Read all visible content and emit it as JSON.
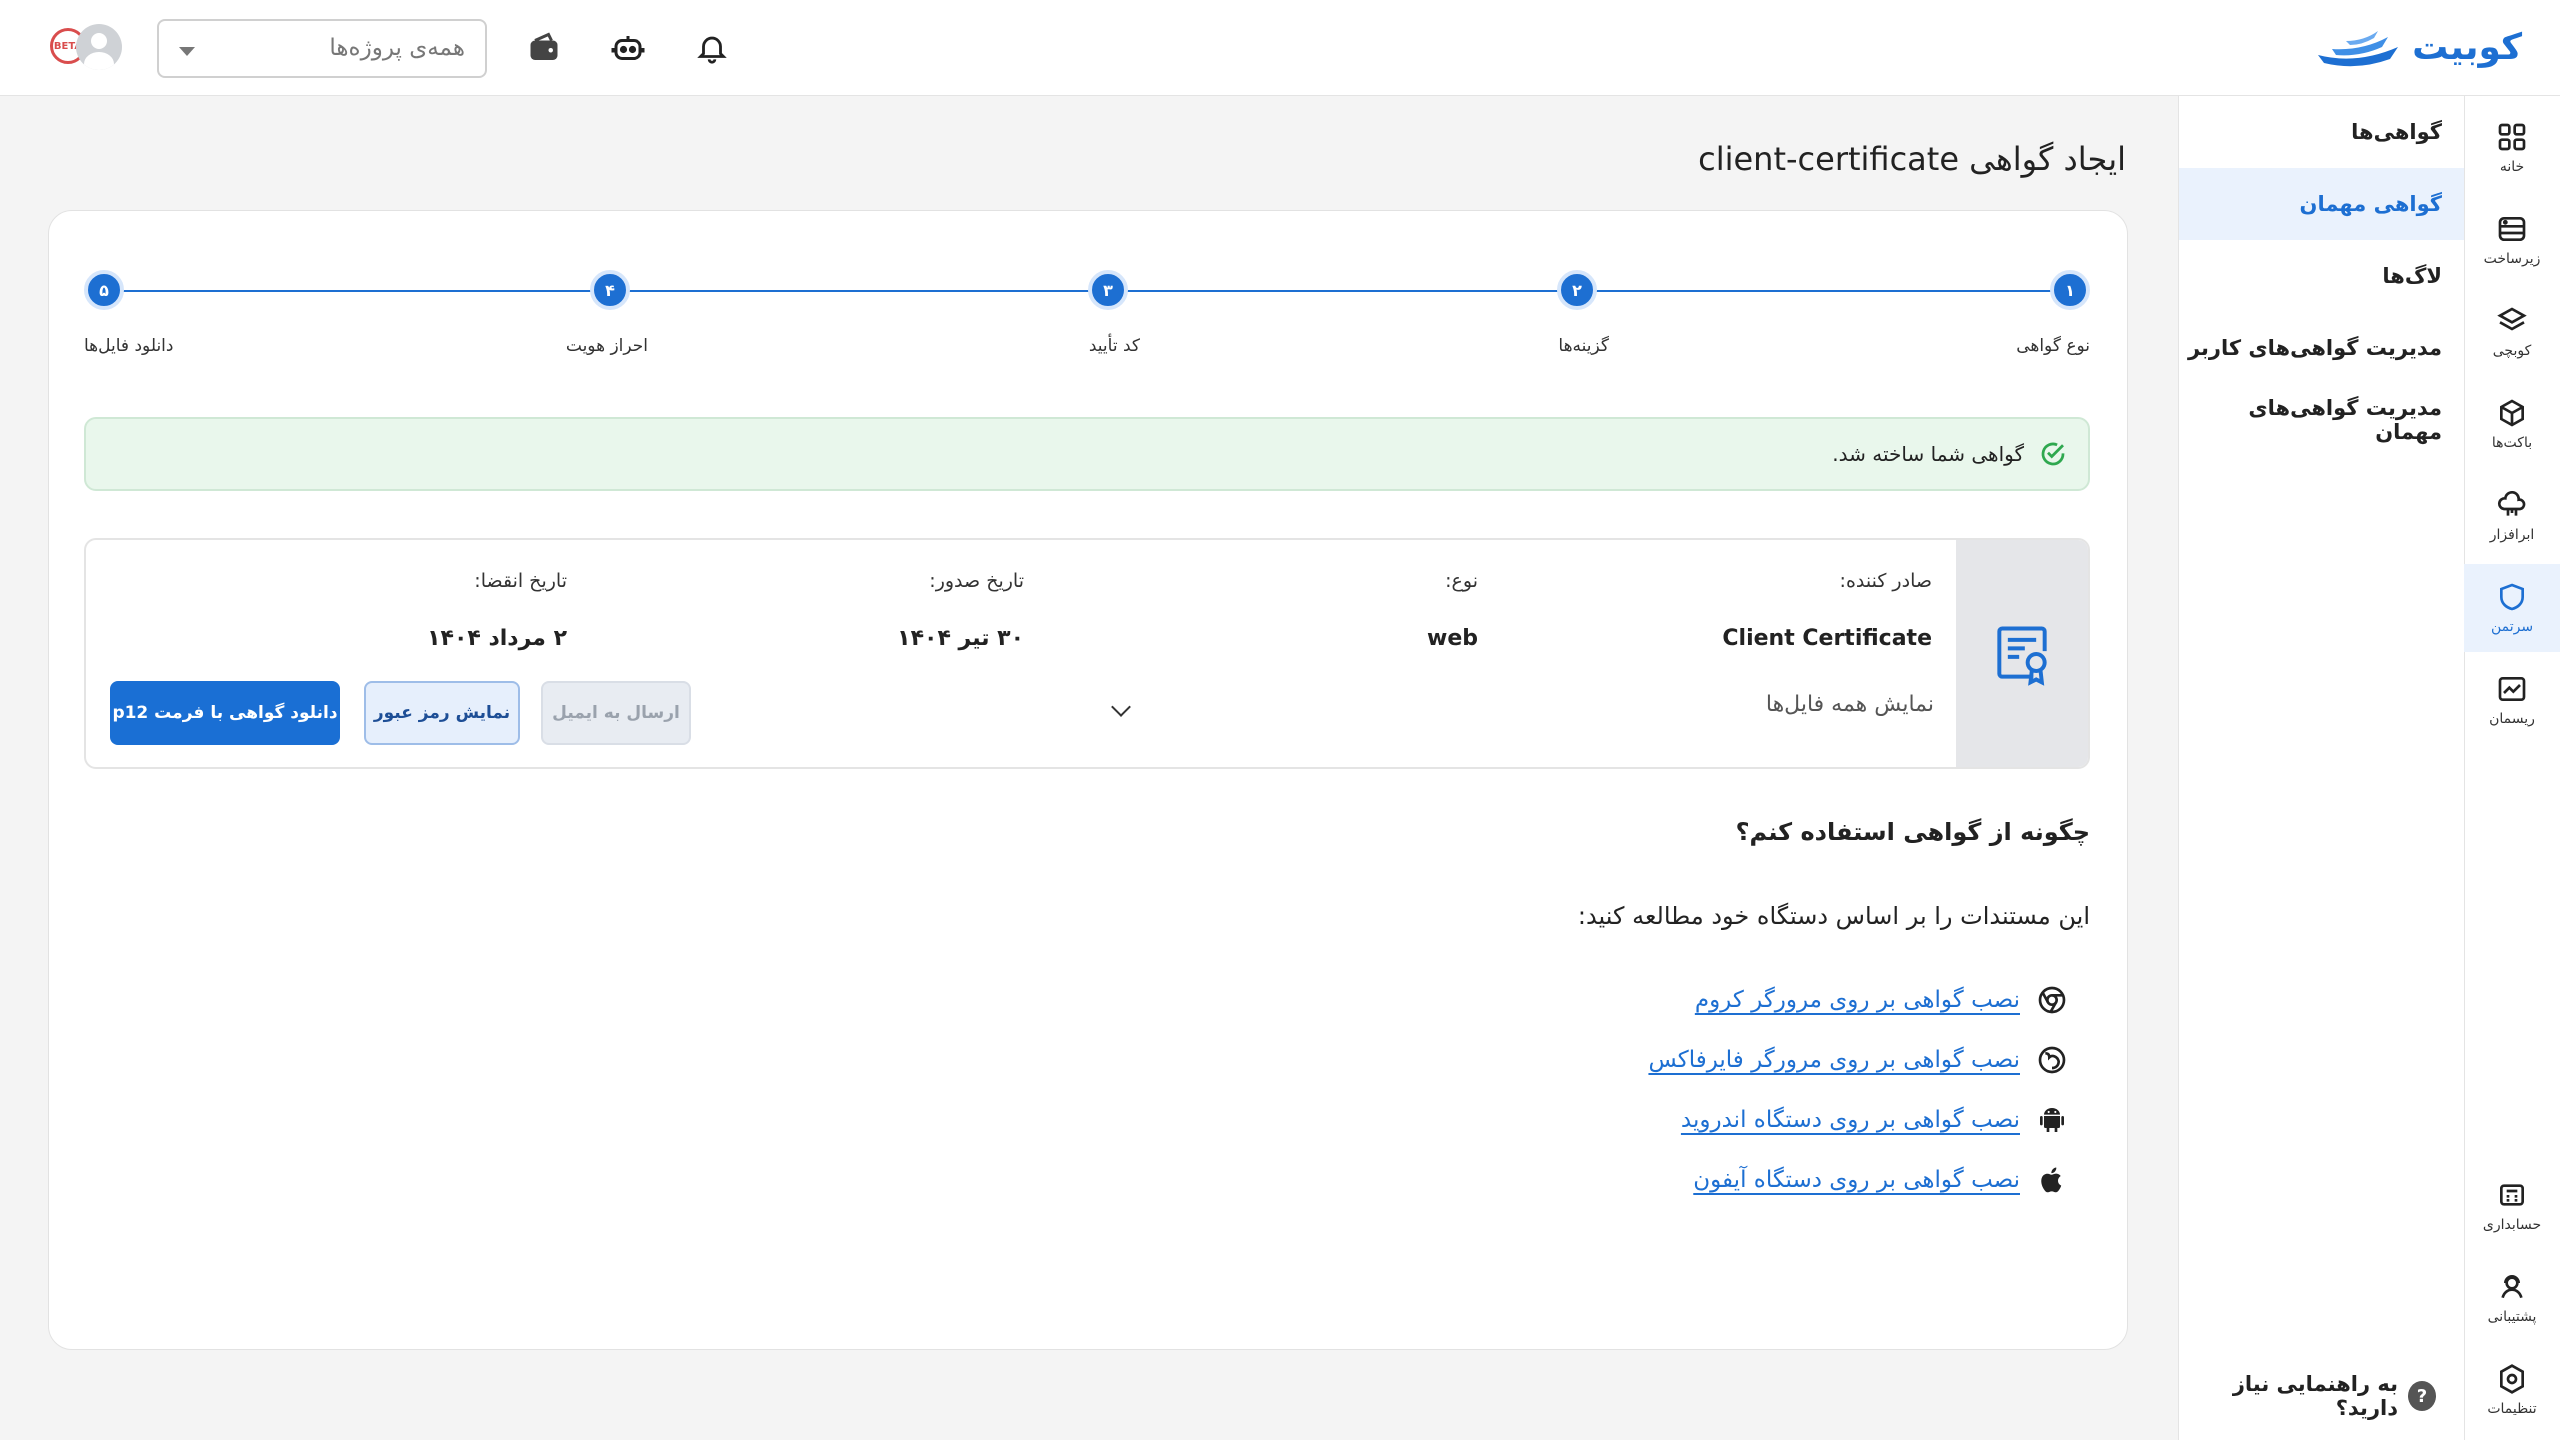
{
  "brand": {
    "name": "کوبیت"
  },
  "topbar": {
    "project_placeholder": "همه‌ی پروژه‌ها",
    "avatar_badge": "BETA"
  },
  "rail": {
    "items": [
      {
        "label": "خانه",
        "icon": "grid-icon"
      },
      {
        "label": "زیرساخت",
        "icon": "server-icon"
      },
      {
        "label": "کوبچی",
        "icon": "layers-icon"
      },
      {
        "label": "باکت‌ها",
        "icon": "cube-icon"
      },
      {
        "label": "ابرافزار",
        "icon": "cloud-app-icon"
      },
      {
        "label": "سرتمن",
        "icon": "shield-icon"
      },
      {
        "label": "ریسمان",
        "icon": "chart-icon"
      }
    ],
    "bottom": [
      {
        "label": "حسابداری",
        "icon": "calculator-icon"
      },
      {
        "label": "پشتیبانی",
        "icon": "support-icon"
      },
      {
        "label": "تنظیمات",
        "icon": "settings-icon"
      }
    ]
  },
  "subnav": {
    "items": [
      {
        "label": "گواهی‌ها"
      },
      {
        "label": "گواهی مهمان"
      },
      {
        "label": "لاگ‌ها"
      },
      {
        "label": "مدیریت گواهی‌های کاربر"
      },
      {
        "label": "مدیریت گواهی‌های مهمان"
      }
    ],
    "help": "به راهنمایی نیاز دارید؟"
  },
  "page": {
    "title": "ایجاد گواهی client-certificate"
  },
  "stepper": {
    "steps": [
      {
        "num": "۱",
        "label": "نوع گواهی"
      },
      {
        "num": "۲",
        "label": "گزینه‌ها"
      },
      {
        "num": "۳",
        "label": "کد تأیید"
      },
      {
        "num": "۴",
        "label": "احراز هویت"
      },
      {
        "num": "۵",
        "label": "دانلود فایل‌ها"
      }
    ]
  },
  "alert": {
    "message": "گواهی شما ساخته شد."
  },
  "certificate": {
    "issuer_label": "صادر کننده:",
    "issuer_value": "Client Certificate",
    "type_label": "نوع:",
    "type_value": "web",
    "issue_label": "تاریخ صدور:",
    "issue_value": "۳۰ تیر ۱۴۰۴",
    "expiry_label": "تاریخ انقضا:",
    "expiry_value": "۲ مرداد ۱۴۰۴",
    "show_files": "نمایش همه فایل‌ها",
    "btn_email": "ارسال به ایمیل",
    "btn_password": "نمایش رمز عبور",
    "btn_download": "دانلود گواهی با فرمت p12"
  },
  "howto": {
    "title": "چگونه از گواهی استفاده کنم؟",
    "subtitle": "این مستندات را بر اساس دستگاه خود مطالعه کنید:",
    "links": [
      {
        "label": "نصب گواهی بر روی مرورگر کروم",
        "icon": "chrome-icon"
      },
      {
        "label": "نصب گواهی بر روی مرورگر فایرفاکس",
        "icon": "firefox-icon"
      },
      {
        "label": "نصب گواهی بر روی دستگاه اندروید",
        "icon": "android-icon"
      },
      {
        "label": "نصب گواهی بر روی دستگاه آیفون",
        "icon": "apple-icon"
      }
    ]
  },
  "colors": {
    "accent": "#1d6fd2",
    "success_bg": "#e9f7ec",
    "success": "#2fa84f"
  }
}
